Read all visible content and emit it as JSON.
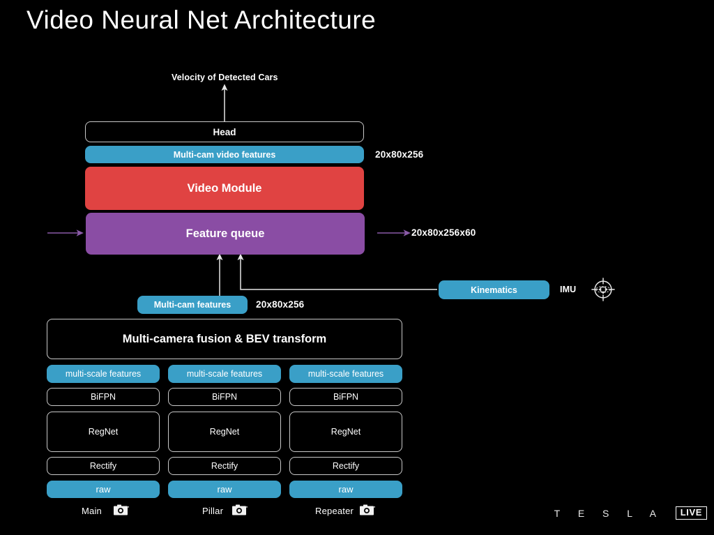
{
  "page": {
    "title": "Video Neural Net Architecture",
    "background_color": "#000000"
  },
  "colors": {
    "blue": "#3a9fc7",
    "red": "#e04342",
    "purple": "#8a4da4",
    "outline": "#c9c9c9",
    "arrow_white": "#e6e6e6",
    "arrow_purple": "#8a5aa8"
  },
  "diagram": {
    "output_label": "Velocity of Detected Cars",
    "head": {
      "label": "Head"
    },
    "multicam_video_features": {
      "label": "Multi-cam video features",
      "dims": "20x80x256"
    },
    "video_module": {
      "label": "Video Module"
    },
    "feature_queue": {
      "label": "Feature queue",
      "dims": "20x80x256x60"
    },
    "multicam_features": {
      "label": "Multi-cam features",
      "dims": "20x80x256"
    },
    "kinematics": {
      "label": "Kinematics"
    },
    "imu": {
      "label": "IMU",
      "icon": "gyroscope-icon"
    },
    "fusion": {
      "label": "Multi-camera fusion & BEV transform"
    },
    "columns": [
      {
        "multi_scale": "multi-scale features",
        "bifpn": "BiFPN",
        "regnet": "RegNet",
        "rectify": "Rectify",
        "raw": "raw",
        "camera": "Main",
        "camera_icon": "camera-icon"
      },
      {
        "multi_scale": "multi-scale features",
        "bifpn": "BiFPN",
        "regnet": "RegNet",
        "rectify": "Rectify",
        "raw": "raw",
        "camera": "Pillar",
        "camera_icon": "camera-icon"
      },
      {
        "multi_scale": "multi-scale features",
        "bifpn": "BiFPN",
        "regnet": "RegNet",
        "rectify": "Rectify",
        "raw": "raw",
        "camera": "Repeater",
        "camera_icon": "camera-icon"
      }
    ]
  },
  "footer": {
    "brand": "T E S L A",
    "live_badge": "LIVE"
  }
}
